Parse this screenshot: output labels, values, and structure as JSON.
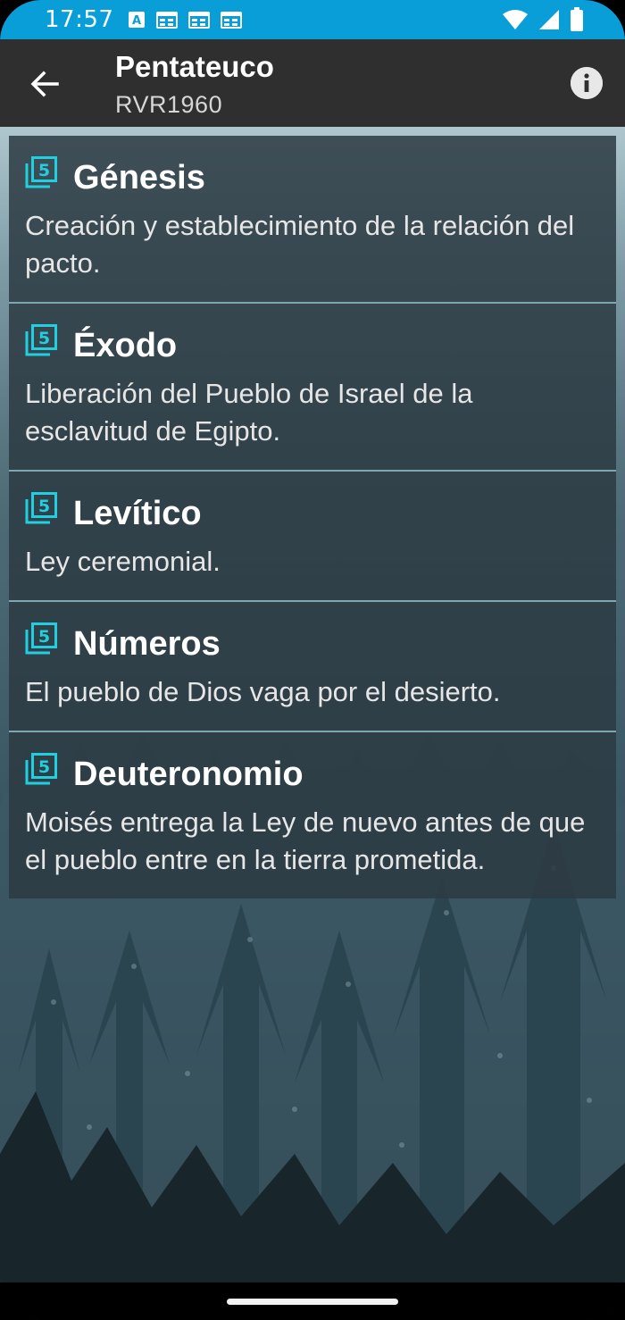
{
  "status_bar": {
    "time": "17:57",
    "left_icons": [
      "a-notification-icon",
      "calendar-icon",
      "calendar-icon",
      "calendar-icon"
    ],
    "right_icons": [
      "wifi-icon",
      "signal-icon",
      "battery-icon"
    ],
    "color": "#0a9ed8"
  },
  "app_bar": {
    "title": "Pentateuco",
    "subtitle": "RVR1960",
    "back_icon": "arrow-back-icon",
    "info_icon": "info-icon"
  },
  "books": [
    {
      "name": "Génesis",
      "description": "Creación y establecimiento de la relación del pacto."
    },
    {
      "name": "Éxodo",
      "description": "Liberación del Pueblo de Israel de la esclavitud de Egipto."
    },
    {
      "name": "Levítico",
      "description": "Ley ceremonial."
    },
    {
      "name": "Números",
      "description": "El pueblo de Dios vaga por el desierto."
    },
    {
      "name": "Deuteronomio",
      "description": "Moisés entrega la Ley de nuevo antes de que el pueblo entre en la tierra prometida."
    }
  ],
  "colors": {
    "accent_icon": "#21d0e0",
    "app_bar": "#2f2f2f",
    "list_item_bg": "#2c3a42",
    "divider": "#7fa6b3"
  }
}
